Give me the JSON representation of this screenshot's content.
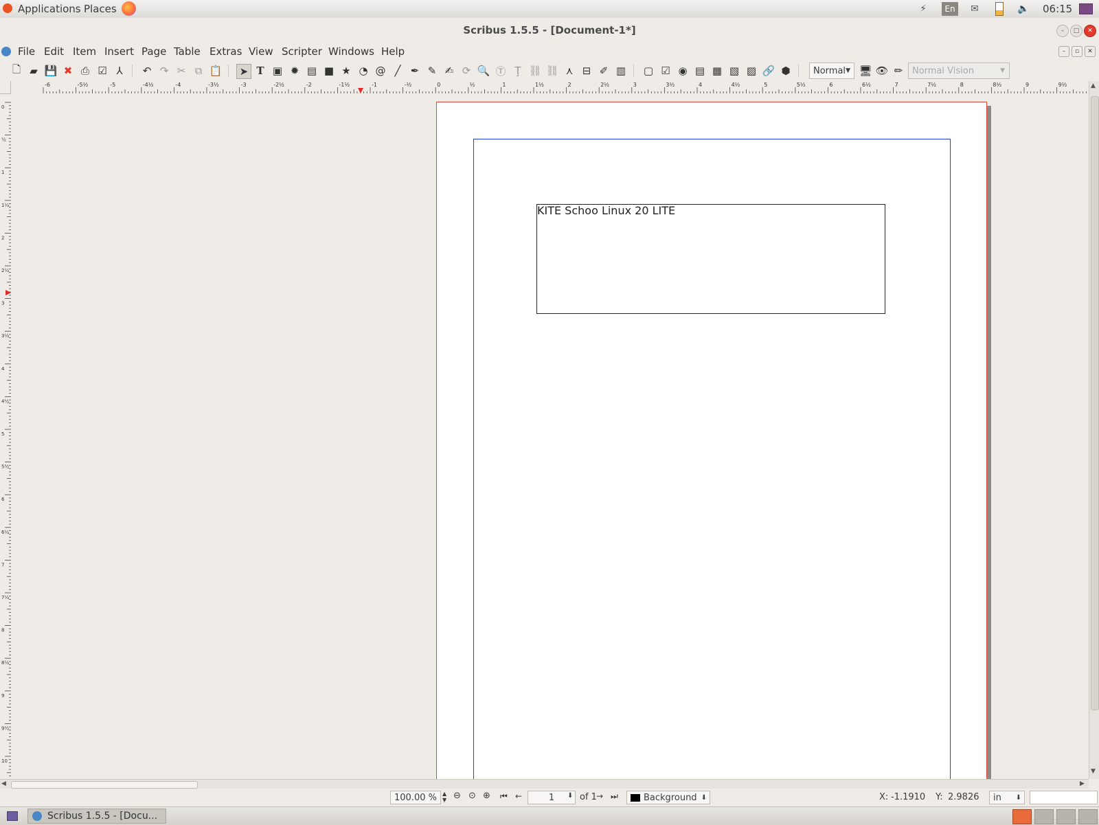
{
  "system_panel": {
    "applications": "Applications",
    "places": "Places",
    "keyboard": "En",
    "clock": "06:15"
  },
  "window": {
    "title": "Scribus 1.5.5 - [Document-1*]"
  },
  "menubar": {
    "items": [
      "File",
      "Edit",
      "Item",
      "Insert",
      "Page",
      "Table",
      "Extras",
      "View",
      "Scripter",
      "Windows",
      "Help"
    ]
  },
  "toolbar": {
    "preview_mode": "Normal",
    "vision_mode": "Normal Vision"
  },
  "rulers": {
    "horizontal_ticks": [
      "-6",
      "-5½",
      "-5",
      "-4½",
      "-4",
      "-3½",
      "-3",
      "-2½",
      "-2",
      "-1½",
      "-1",
      "-½",
      "0",
      "½",
      "1",
      "1½",
      "2",
      "2½",
      "3",
      "3½",
      "4",
      "4½",
      "5",
      "5½",
      "6",
      "6½",
      "7",
      "7½",
      "8",
      "8½",
      "9",
      "9½"
    ],
    "vertical_ticks": [
      "0",
      "½",
      "1",
      "1½",
      "2",
      "2½",
      "3",
      "3½",
      "4",
      "4½",
      "5",
      "5½",
      "6",
      "6½",
      "7",
      "7½",
      "8",
      "8½",
      "9",
      "9½",
      "10"
    ]
  },
  "document": {
    "text_frame_content": "KITE Schoo Linux 20 LITE"
  },
  "statusbar": {
    "zoom": "100.00 %",
    "current_page": "1",
    "page_total": "of 1",
    "layer": "Background",
    "x_label": "X:",
    "x_value": "-1.1910",
    "y_label": "Y:",
    "y_value": "2.9826",
    "unit": "in"
  },
  "taskbar": {
    "task_label": "Scribus 1.5.5 - [Docu..."
  },
  "colors": {
    "page_border": "#e0473a",
    "margin_guide": "#2a3ad6",
    "close_red": "#e23b2e"
  }
}
